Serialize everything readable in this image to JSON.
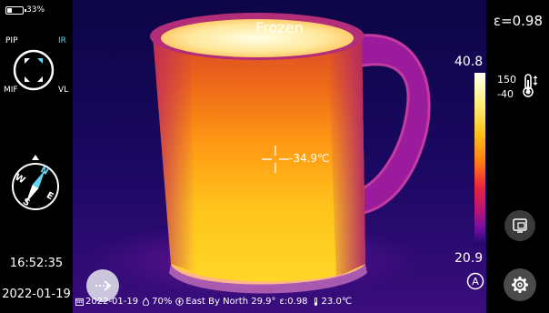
{
  "status": {
    "battery_text": "33%",
    "battery_level": 0.33
  },
  "modes": {
    "pip": "PIP",
    "ir": "IR",
    "mif": "MIF",
    "vl": "VL",
    "active": "IR"
  },
  "compass": {
    "n": "N",
    "e": "E",
    "s": "S",
    "w": "W",
    "heading_deg": 29.9
  },
  "clock": {
    "time": "16:52:35",
    "date": "2022-01-19"
  },
  "view": {
    "title": "Frozen",
    "spot_temperature": "-34.9℃"
  },
  "status_bar": {
    "date": "2022-01-19",
    "humidity": "70%",
    "direction": "East By North 29.9°",
    "emissivity": "ε:0.98",
    "ambient": "23.0℃"
  },
  "right": {
    "emissivity": "ε=0.98",
    "range_high": "150",
    "range_low": "-40",
    "monitor_icon": "screen-settings-icon",
    "settings_icon": "gear-icon"
  },
  "scale": {
    "max": "40.8",
    "min": "20.9",
    "mode_letter": "A"
  },
  "icons": {
    "fab": "arrow-right-icon",
    "calendar": "calendar-icon",
    "humidity": "droplet-icon",
    "direction": "compass-small-icon",
    "thermo": "thermometer-icon"
  },
  "colors": {
    "ir_active": "#5fd7f5",
    "background": "#000000",
    "palette_hot": "#fffff0",
    "palette_cold": "#1d0766"
  }
}
